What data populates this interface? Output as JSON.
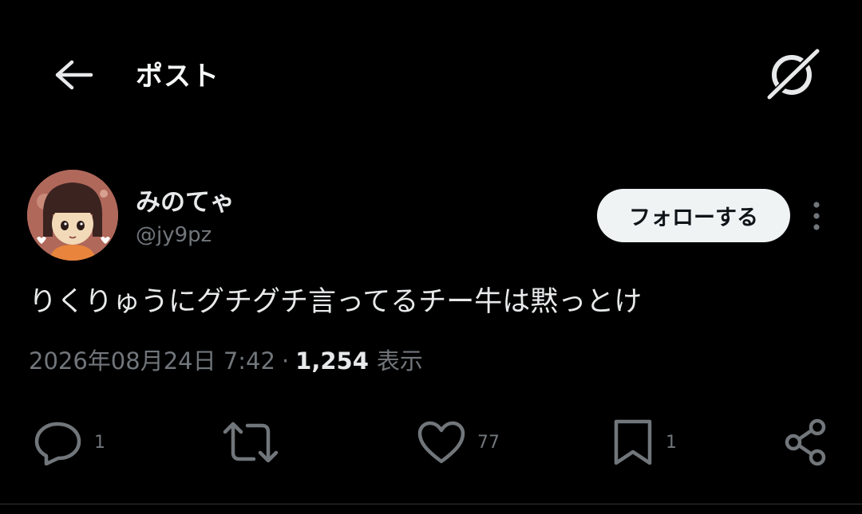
{
  "header": {
    "title": "ポスト",
    "back_icon": "arrow-left-icon",
    "grok_icon": "grok-icon"
  },
  "author": {
    "name": "みのてゃ",
    "handle": "@jy9pz",
    "follow_label": "フォローする",
    "more_icon": "more-vertical-icon"
  },
  "post": {
    "text": "りくりゅうにグチグチ言ってるチー牛は黙っとけ",
    "date": "2026年08月24日 7:42",
    "separator": "·",
    "views_count": "1,254",
    "views_label": "表示"
  },
  "actions": {
    "reply_count": "1",
    "repost_count": "",
    "like_count": "77",
    "bookmark_count": "1"
  },
  "colors": {
    "background": "#000000",
    "text_primary": "#e7e9ea",
    "text_secondary": "#71767b",
    "follow_bg": "#eff3f4",
    "follow_text": "#0f1419"
  }
}
